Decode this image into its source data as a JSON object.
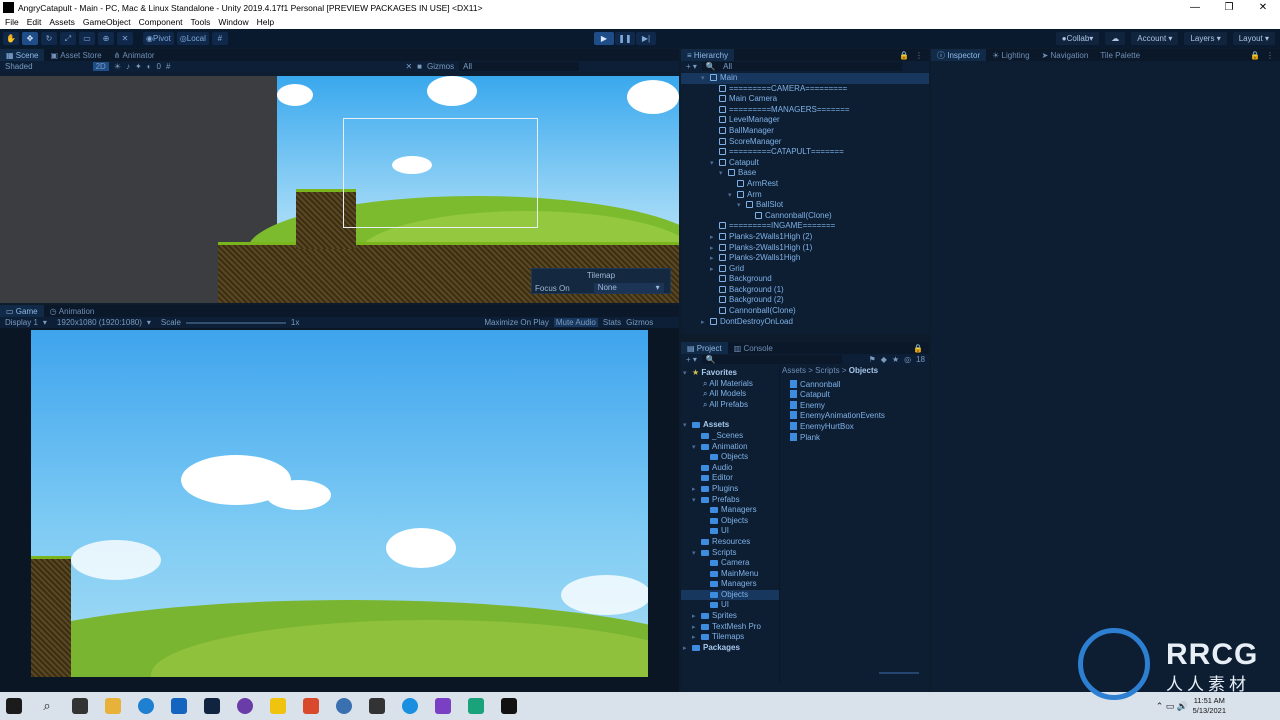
{
  "window": {
    "title": "AngryCatapult - Main - PC, Mac & Linux Standalone - Unity 2019.4.17f1 Personal [PREVIEW PACKAGES IN USE] <DX11>",
    "controls": [
      "—",
      "❐",
      "✕"
    ]
  },
  "menu": [
    "File",
    "Edit",
    "Assets",
    "GameObject",
    "Component",
    "Tools",
    "Window",
    "Help"
  ],
  "toolbar": {
    "pivot": "Pivot",
    "local": "Local",
    "collab": "Collab",
    "account": "Account",
    "layers": "Layers",
    "layout": "Layout"
  },
  "scene_panel": {
    "tabs": [
      "Scene",
      "Asset Store",
      "Animator"
    ],
    "shading": "Shaded",
    "mode_2d": "2D",
    "gizmos": "Gizmos",
    "search_placeholder": "All",
    "gizmo_count": "0",
    "tilemap": {
      "title": "Tilemap",
      "focus_label": "Focus On",
      "focus_value": "None"
    }
  },
  "game_panel": {
    "tabs": [
      "Game",
      "Animation"
    ],
    "display": "Display 1",
    "resolution": "1920x1080 (1920:1080)",
    "scale_label": "Scale",
    "scale_value": "1x",
    "maximize": "Maximize On Play",
    "mute": "Mute Audio",
    "stats": "Stats",
    "gizmos": "Gizmos"
  },
  "hierarchy": {
    "tab": "Hierarchy",
    "search_placeholder": "All",
    "items": [
      {
        "label": "Main",
        "depth": 0
      },
      {
        "label": "=========CAMERA=========",
        "depth": 1
      },
      {
        "label": "Main Camera",
        "depth": 1
      },
      {
        "label": "=========MANAGERS=======",
        "depth": 1
      },
      {
        "label": "LevelManager",
        "depth": 1
      },
      {
        "label": "BallManager",
        "depth": 1
      },
      {
        "label": "ScoreManager",
        "depth": 1
      },
      {
        "label": "=========CATAPULT=======",
        "depth": 1
      },
      {
        "label": "Catapult",
        "depth": 1
      },
      {
        "label": "Base",
        "depth": 2
      },
      {
        "label": "ArmRest",
        "depth": 3
      },
      {
        "label": "Arm",
        "depth": 3
      },
      {
        "label": "BallSlot",
        "depth": 4
      },
      {
        "label": "Cannonball(Clone)",
        "depth": 5
      },
      {
        "label": "=========INGAME=======",
        "depth": 1
      },
      {
        "label": "Planks-2Walls1High (2)",
        "depth": 1
      },
      {
        "label": "Planks-2Walls1High (1)",
        "depth": 1
      },
      {
        "label": "Planks-2Walls1High",
        "depth": 1
      },
      {
        "label": "Grid",
        "depth": 1
      },
      {
        "label": "Background",
        "depth": 1
      },
      {
        "label": "Background (1)",
        "depth": 1
      },
      {
        "label": "Background (2)",
        "depth": 1
      },
      {
        "label": "Cannonball(Clone)",
        "depth": 1
      },
      {
        "label": "DontDestroyOnLoad",
        "depth": 0
      }
    ]
  },
  "inspector": {
    "tabs": [
      "Inspector",
      "Lighting",
      "Navigation",
      "Tile Palette"
    ]
  },
  "project": {
    "tabs": [
      "Project",
      "Console"
    ],
    "badge": "18",
    "breadcrumb": [
      "Assets",
      "Scripts",
      "Objects"
    ],
    "favorites": {
      "label": "Favorites",
      "items": [
        "All Materials",
        "All Models",
        "All Prefabs"
      ]
    },
    "assets_tree": [
      {
        "label": "Assets",
        "depth": 0
      },
      {
        "label": "_Scenes",
        "depth": 1
      },
      {
        "label": "Animation",
        "depth": 1
      },
      {
        "label": "Objects",
        "depth": 2
      },
      {
        "label": "Audio",
        "depth": 1
      },
      {
        "label": "Editor",
        "depth": 1
      },
      {
        "label": "Plugins",
        "depth": 1
      },
      {
        "label": "Prefabs",
        "depth": 1
      },
      {
        "label": "Managers",
        "depth": 2
      },
      {
        "label": "Objects",
        "depth": 2
      },
      {
        "label": "UI",
        "depth": 2
      },
      {
        "label": "Resources",
        "depth": 1
      },
      {
        "label": "Scripts",
        "depth": 1
      },
      {
        "label": "Camera",
        "depth": 2
      },
      {
        "label": "MainMenu",
        "depth": 2
      },
      {
        "label": "Managers",
        "depth": 2
      },
      {
        "label": "Objects",
        "depth": 2
      },
      {
        "label": "UI",
        "depth": 2
      },
      {
        "label": "Sprites",
        "depth": 1
      },
      {
        "label": "TextMesh Pro",
        "depth": 1
      },
      {
        "label": "Tilemaps",
        "depth": 1
      },
      {
        "label": "Packages",
        "depth": 0
      }
    ],
    "files": [
      "Cannonball",
      "Catapult",
      "Enemy",
      "EnemyAnimationEvents",
      "EnemyHurtBox",
      "Plank"
    ]
  },
  "taskbar": {
    "time": "11:51 AM",
    "date": "5/13/2021"
  },
  "watermark": {
    "brand": "RRCG",
    "sub": "人人素材"
  },
  "colors": {
    "accent": "#1e4d88",
    "panel": "#0d1e33",
    "text": "#7fb1e6"
  }
}
